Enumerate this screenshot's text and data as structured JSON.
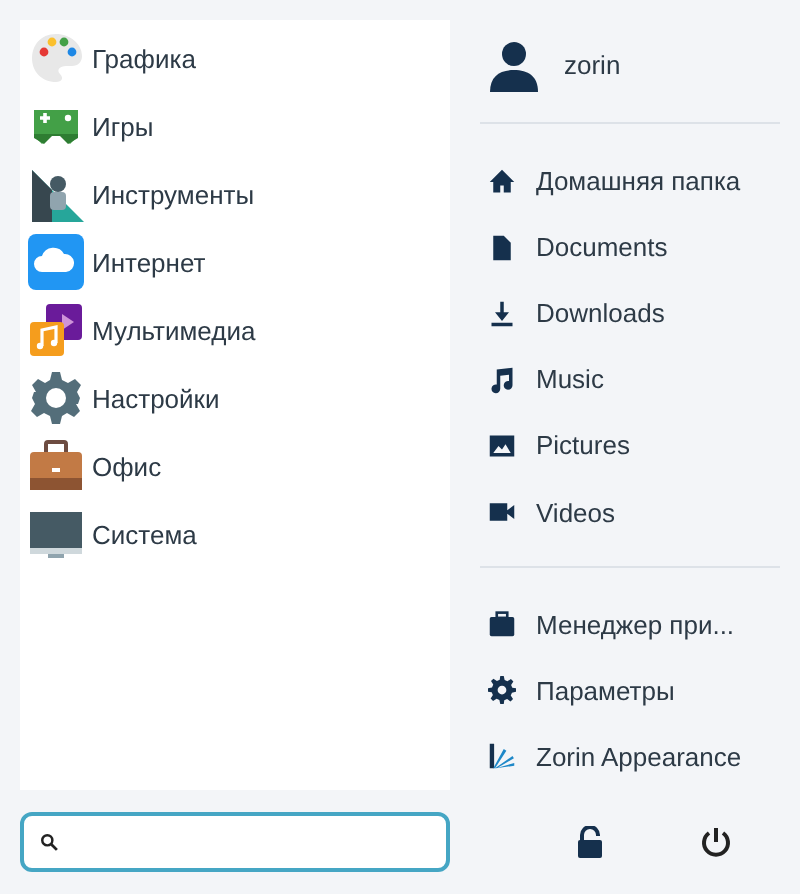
{
  "categories": [
    {
      "label": "Графика"
    },
    {
      "label": "Игры"
    },
    {
      "label": "Инструменты"
    },
    {
      "label": "Интернет"
    },
    {
      "label": "Мультимедиа"
    },
    {
      "label": "Настройки"
    },
    {
      "label": "Офис"
    },
    {
      "label": "Система"
    }
  ],
  "user": {
    "name": "zorin"
  },
  "places": [
    {
      "label": "Домашняя папка"
    },
    {
      "label": "Documents"
    },
    {
      "label": "Downloads"
    },
    {
      "label": "Music"
    },
    {
      "label": "Pictures"
    },
    {
      "label": "Videos"
    }
  ],
  "shortcuts": [
    {
      "label": "Менеджер при..."
    },
    {
      "label": "Параметры"
    },
    {
      "label": "Zorin Appearance"
    }
  ],
  "search": {
    "focused": true
  }
}
